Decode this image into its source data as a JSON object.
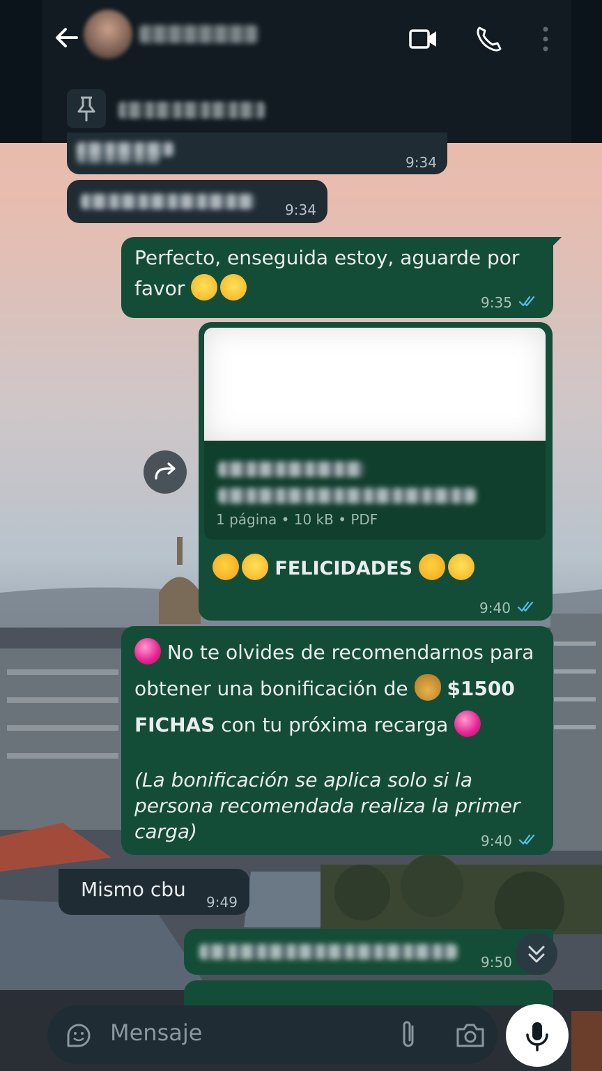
{
  "header": {
    "back_icon": "arrow-left-icon",
    "contact_name": "",
    "pinned_text": "",
    "icons": [
      "video-call-icon",
      "voice-call-icon",
      "more-vertical-icon"
    ]
  },
  "messages": [
    {
      "id": "m1",
      "direction": "incoming",
      "text": "",
      "time": "9:34"
    },
    {
      "id": "m2",
      "direction": "incoming",
      "text": "",
      "time": "9:34"
    },
    {
      "id": "m3",
      "direction": "outgoing",
      "text": "Perfecto, enseguida estoy, aguarde por favor",
      "time": "9:35",
      "status": "read"
    },
    {
      "id": "m4",
      "direction": "outgoing",
      "document": {
        "meta": "1 página • 10 kB • PDF"
      },
      "caption": "FELICIDADES",
      "time": "9:40",
      "status": "read"
    },
    {
      "id": "m5",
      "direction": "outgoing",
      "line1": "No te olvides de recomendarnos para",
      "line2_a": "obtener una bonificación de",
      "line2_b": "$1500",
      "line3_a": "FICHAS",
      "line3_b": "con tu próxima recarga",
      "note1": "(La bonificación se aplica solo si la",
      "note2": "persona recomendada realiza la primer",
      "note3": "carga)",
      "time": "9:40",
      "status": "read"
    },
    {
      "id": "m6",
      "direction": "incoming",
      "text": "Mismo cbu",
      "time": "9:49"
    },
    {
      "id": "m7",
      "direction": "outgoing",
      "text": "",
      "time": "9:50"
    }
  ],
  "composer": {
    "placeholder": "Mensaje",
    "icons": [
      "sticker-icon",
      "attach-icon",
      "camera-icon",
      "mic-icon"
    ]
  },
  "colors": {
    "incoming": "#1f2c34",
    "outgoing": "#144d37",
    "read_ticks": "#53bdeb"
  }
}
